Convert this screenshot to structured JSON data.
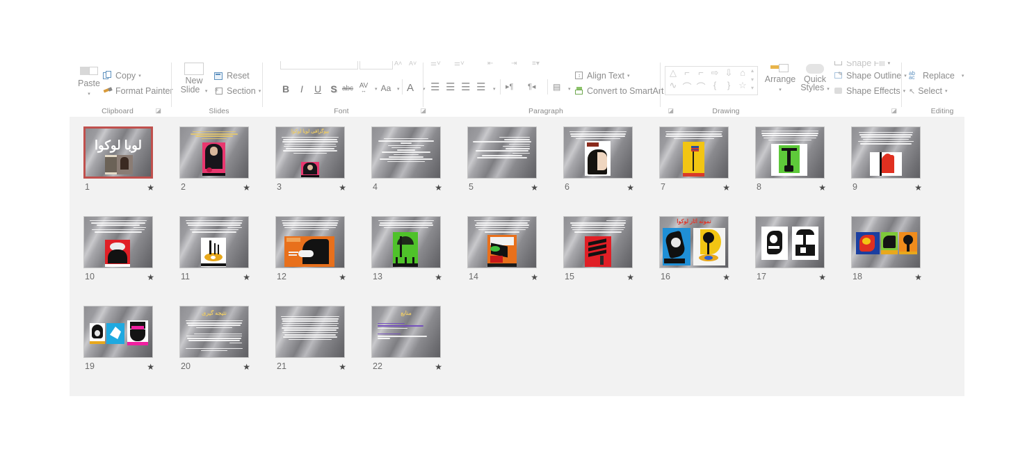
{
  "app": {
    "name": "Microsoft PowerPoint",
    "view": "Slide Sorter"
  },
  "ribbon": {
    "groups": [
      {
        "label": "Clipboard",
        "items": [
          {
            "name": "paste-button",
            "label": "Paste",
            "icon": "clipboard-icon"
          },
          {
            "name": "copy-button",
            "label": "Copy",
            "icon": "copy-icon"
          },
          {
            "name": "format-painter-button",
            "label": "Format Painter",
            "icon": "paintbrush-icon"
          }
        ],
        "dialog_launcher": true
      },
      {
        "label": "Slides",
        "items": [
          {
            "name": "new-slide-button",
            "label": "New Slide",
            "icon": "new-slide-icon"
          },
          {
            "name": "reset-button",
            "label": "Reset",
            "icon": "reset-icon"
          },
          {
            "name": "section-button",
            "label": "Section",
            "icon": "section-icon"
          }
        ],
        "dialog_launcher": false
      },
      {
        "label": "Font",
        "items": [
          {
            "name": "bold-button",
            "label": "B"
          },
          {
            "name": "italic-button",
            "label": "I"
          },
          {
            "name": "underline-button",
            "label": "U"
          },
          {
            "name": "text-shadow-button",
            "label": "S"
          },
          {
            "name": "strikethrough-button",
            "label": "abc"
          },
          {
            "name": "character-spacing-button",
            "label": "AV"
          },
          {
            "name": "change-case-button",
            "label": "Aa"
          },
          {
            "name": "font-color-button",
            "label": "A"
          }
        ],
        "dialog_launcher": true
      },
      {
        "label": "Paragraph",
        "items": [
          {
            "name": "align-left-button",
            "label": ""
          },
          {
            "name": "align-center-button",
            "label": ""
          },
          {
            "name": "align-right-button",
            "label": ""
          },
          {
            "name": "justify-button",
            "label": ""
          },
          {
            "name": "text-direction-rtl-button",
            "label": ""
          },
          {
            "name": "text-direction-ltr-button",
            "label": ""
          },
          {
            "name": "columns-button",
            "label": ""
          },
          {
            "name": "align-text-button",
            "label": "Align Text",
            "icon": "align-text-icon"
          },
          {
            "name": "convert-to-smartart-button",
            "label": "Convert to SmartArt",
            "icon": "smartart-icon"
          }
        ],
        "dialog_launcher": true
      },
      {
        "label": "Drawing",
        "items": [
          {
            "name": "shapes-gallery",
            "label": ""
          },
          {
            "name": "arrange-button",
            "label": "Arrange",
            "icon": "arrange-icon"
          },
          {
            "name": "quick-styles-button",
            "label": "Quick Styles",
            "icon": "quick-styles-icon"
          },
          {
            "name": "shape-fill-button",
            "label": "Shape Fill",
            "icon": "shape-fill-icon"
          },
          {
            "name": "shape-outline-button",
            "label": "Shape Outline",
            "icon": "shape-outline-icon"
          },
          {
            "name": "shape-effects-button",
            "label": "Shape Effects",
            "icon": "shape-effects-icon"
          }
        ],
        "dialog_launcher": true
      },
      {
        "label": "Editing",
        "items": [
          {
            "name": "replace-button",
            "label": "Replace",
            "icon": "replace-icon"
          },
          {
            "name": "select-button",
            "label": "Select",
            "icon": "select-arrow-icon"
          }
        ],
        "dialog_launcher": false
      }
    ]
  },
  "sorter": {
    "selected_slide": 1,
    "star_glyph": "★",
    "slides": [
      {
        "number": "1",
        "kind": "title",
        "title": "لوبا لوكوا",
        "has_image": true
      },
      {
        "number": "2",
        "kind": "text-image",
        "title": "",
        "has_image": true
      },
      {
        "number": "3",
        "kind": "text-image",
        "title": "بیوگرافی لوبا لوکوا",
        "has_image": true
      },
      {
        "number": "4",
        "kind": "text",
        "title": "",
        "has_image": false
      },
      {
        "number": "5",
        "kind": "text",
        "title": "",
        "has_image": false
      },
      {
        "number": "6",
        "kind": "text-image",
        "title": "",
        "has_image": true
      },
      {
        "number": "7",
        "kind": "text-image",
        "title": "",
        "has_image": true
      },
      {
        "number": "8",
        "kind": "text-image",
        "title": "",
        "has_image": true
      },
      {
        "number": "9",
        "kind": "text-image",
        "title": "",
        "has_image": true
      },
      {
        "number": "10",
        "kind": "text-image",
        "title": "",
        "has_image": true
      },
      {
        "number": "11",
        "kind": "text-image",
        "title": "",
        "has_image": true
      },
      {
        "number": "12",
        "kind": "text-image",
        "title": "",
        "has_image": true
      },
      {
        "number": "13",
        "kind": "text-image",
        "title": "",
        "has_image": true
      },
      {
        "number": "14",
        "kind": "text-image",
        "title": "",
        "has_image": true
      },
      {
        "number": "15",
        "kind": "text-image",
        "title": "",
        "has_image": true
      },
      {
        "number": "16",
        "kind": "gallery",
        "title": "نمونه آثار لوکوا",
        "has_image": true
      },
      {
        "number": "17",
        "kind": "gallery",
        "title": "",
        "has_image": true
      },
      {
        "number": "18",
        "kind": "gallery",
        "title": "",
        "has_image": true
      },
      {
        "number": "19",
        "kind": "gallery",
        "title": "",
        "has_image": true
      },
      {
        "number": "20",
        "kind": "text",
        "title": "نتیجه گیری",
        "has_image": false
      },
      {
        "number": "21",
        "kind": "text",
        "title": "",
        "has_image": false
      },
      {
        "number": "22",
        "kind": "links",
        "title": "منابع",
        "has_image": false
      }
    ]
  },
  "colors": {
    "selection_border": "#c0504d",
    "sorter_background": "#f2f2f2",
    "ribbon_text": "#8c8c8c",
    "slide_title_gold": "#e8c96a",
    "hyperlink": "#6e46be"
  }
}
